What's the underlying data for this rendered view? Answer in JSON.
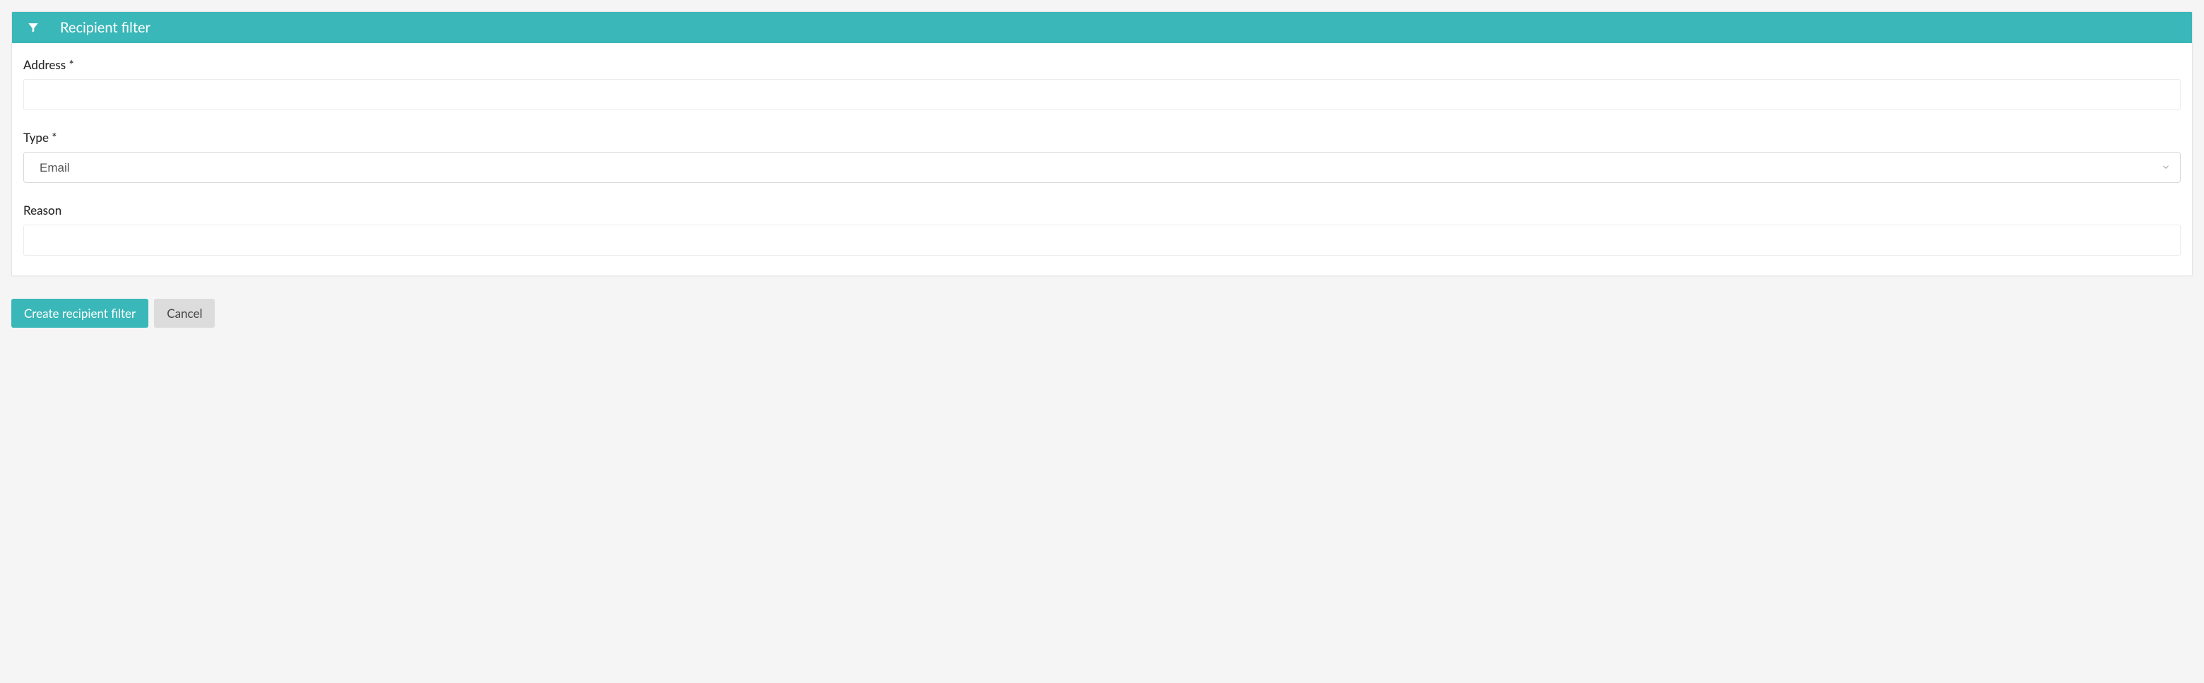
{
  "panel": {
    "title": "Recipient filter"
  },
  "form": {
    "address": {
      "label": "Address *",
      "value": ""
    },
    "type": {
      "label": "Type *",
      "selected": "Email"
    },
    "reason": {
      "label": "Reason",
      "value": ""
    }
  },
  "actions": {
    "create_label": "Create recipient filter",
    "cancel_label": "Cancel"
  }
}
